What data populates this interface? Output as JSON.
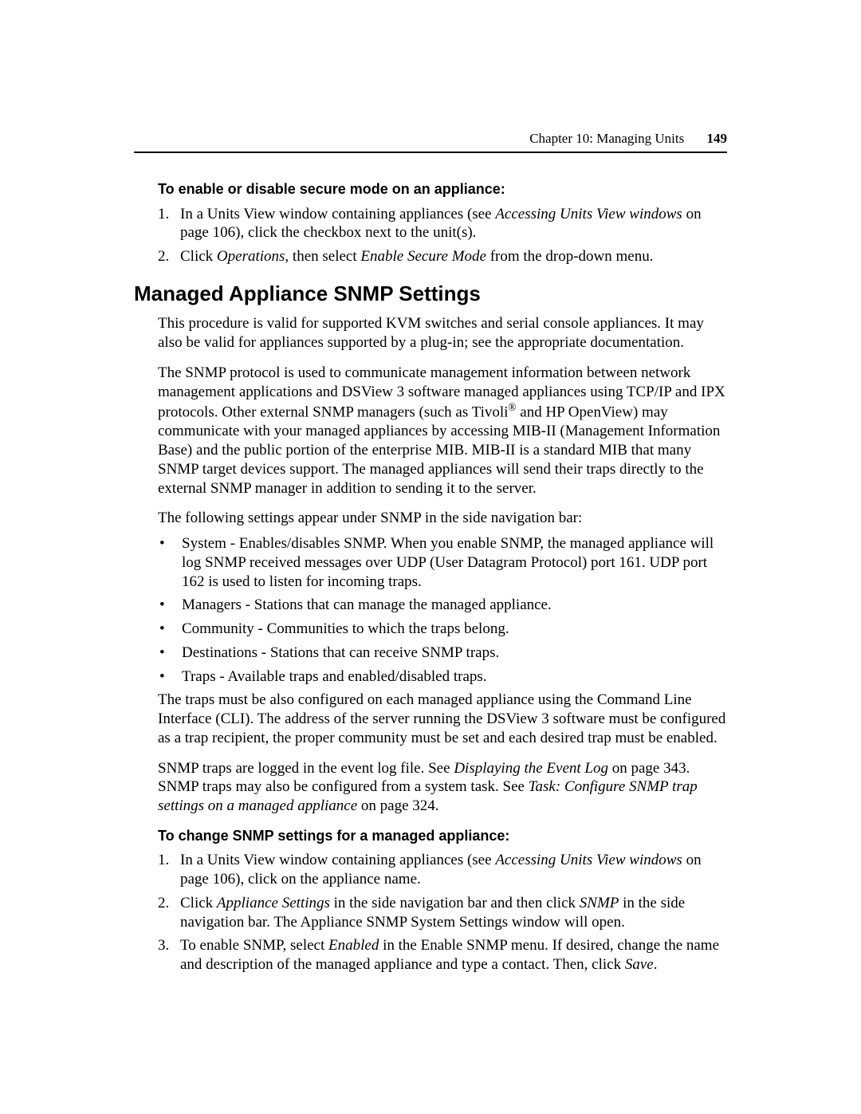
{
  "header": {
    "chapter": "Chapter 10: Managing Units",
    "page_number": "149"
  },
  "sec1": {
    "lead": "To enable or disable secure mode on an appliance:",
    "steps": {
      "s1": {
        "num": "1.",
        "a": "In a Units View window containing appliances (see ",
        "ref": "Accessing Units View windows",
        "b": " on page 106), click the checkbox next to the unit(s)."
      },
      "s2": {
        "num": "2.",
        "a": "Click ",
        "op": "Operations",
        "b": ", then select ",
        "esm": "Enable Secure Mode",
        "c": " from the drop-down menu."
      }
    }
  },
  "h2": "Managed Appliance SNMP Settings",
  "p1": "This procedure is valid for supported KVM switches and serial console appliances. It may also be valid for appliances supported by a plug-in; see the appropriate documentation.",
  "p2": {
    "a": "The SNMP protocol is used to communicate management information between network management applications and DSView 3 software managed appliances using TCP/IP and IPX protocols. Other external SNMP managers (such as Tivoli",
    "reg": "®",
    "b": " and HP OpenView) may communicate with your managed appliances by accessing MIB-II (Management Information Base) and the public portion of the enterprise MIB. MIB-II is a standard MIB that many SNMP target devices support. The managed appliances will send their traps directly to the external SNMP manager in addition to sending it to the server."
  },
  "p3": "The following settings appear under SNMP in the side navigation bar:",
  "bullets": {
    "b1": "System - Enables/disables SNMP. When you enable SNMP, the managed appliance will log SNMP received messages over UDP (User Datagram Protocol) port 161. UDP port 162 is used to listen for incoming traps.",
    "b2": "Managers - Stations that can manage the managed appliance.",
    "b3": "Community - Communities to which the traps belong.",
    "b4": "Destinations - Stations that can receive SNMP traps.",
    "b5": "Traps - Available traps and enabled/disabled traps."
  },
  "p4": "The traps must be also configured on each managed appliance using the Command Line Interface (CLI). The address of the server running the DSView 3 software must be configured as a trap recipient, the proper community must be set and each desired trap must be enabled.",
  "p5": {
    "a": "SNMP traps are logged in the event log file. See ",
    "ref1": "Displaying the Event Log",
    "b": " on page 343. SNMP traps may also be configured from a system task. See ",
    "ref2": "Task: Configure SNMP trap settings on a managed appliance",
    "c": " on page 324."
  },
  "sec2": {
    "lead": "To change SNMP settings for a managed appliance:",
    "steps": {
      "s1": {
        "num": "1.",
        "a": "In a Units View window containing appliances (see ",
        "ref": "Accessing Units View windows",
        "b": " on page 106), click on the appliance name."
      },
      "s2": {
        "num": "2.",
        "a": "Click ",
        "as": "Appliance Settings",
        "b": " in the side navigation bar and then click ",
        "snmp": "SNMP",
        "c": " in the side navigation bar. The Appliance SNMP System Settings window will open."
      },
      "s3": {
        "num": "3.",
        "a": "To enable SNMP, select ",
        "en": "Enabled",
        "b": " in the Enable SNMP menu. If desired, change the name and description of the managed appliance and type a contact. Then, click ",
        "save": "Save",
        "c": "."
      }
    }
  },
  "dot": "•"
}
